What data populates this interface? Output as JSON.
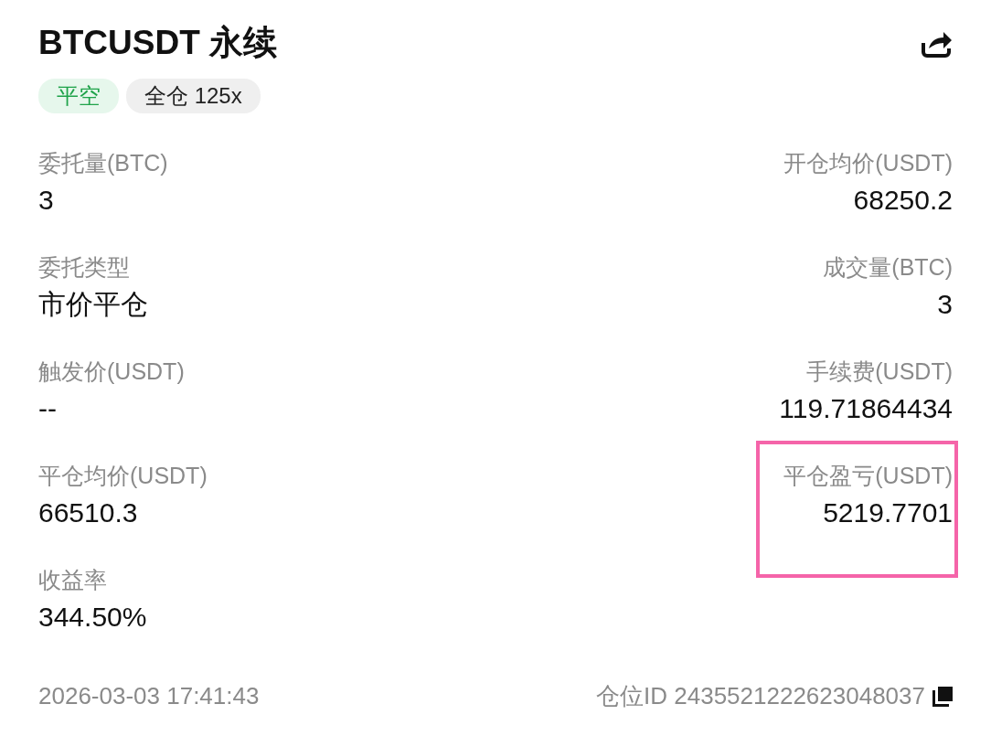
{
  "header": {
    "title": "BTCUSDT 永续"
  },
  "tags": [
    {
      "kind": "side",
      "label": "平空"
    },
    {
      "kind": "margin",
      "label": "全仓 125x"
    }
  ],
  "fields": [
    [
      {
        "label": "委托量(BTC)",
        "value": "3",
        "highlighted": false
      },
      {
        "label": "开仓均价(USDT)",
        "value": "68250.2",
        "highlighted": false
      }
    ],
    [
      {
        "label": "委托类型",
        "value": "市价平仓",
        "highlighted": false
      },
      {
        "label": "成交量(BTC)",
        "value": "3",
        "highlighted": false
      }
    ],
    [
      {
        "label": "触发价(USDT)",
        "value": "--",
        "highlighted": false
      },
      {
        "label": "手续费(USDT)",
        "value": "119.71864434",
        "highlighted": false
      }
    ],
    [
      {
        "label": "平仓均价(USDT)",
        "value": "66510.3",
        "highlighted": false
      },
      {
        "label": "平仓盈亏(USDT)",
        "value": "5219.7701",
        "highlighted": true
      }
    ],
    [
      {
        "label": "收益率",
        "value": "344.50%",
        "highlighted": false
      }
    ]
  ],
  "footer": {
    "time": "2026-03-03 17:41:43",
    "position_id": "仓位ID 2435521222623048037"
  }
}
